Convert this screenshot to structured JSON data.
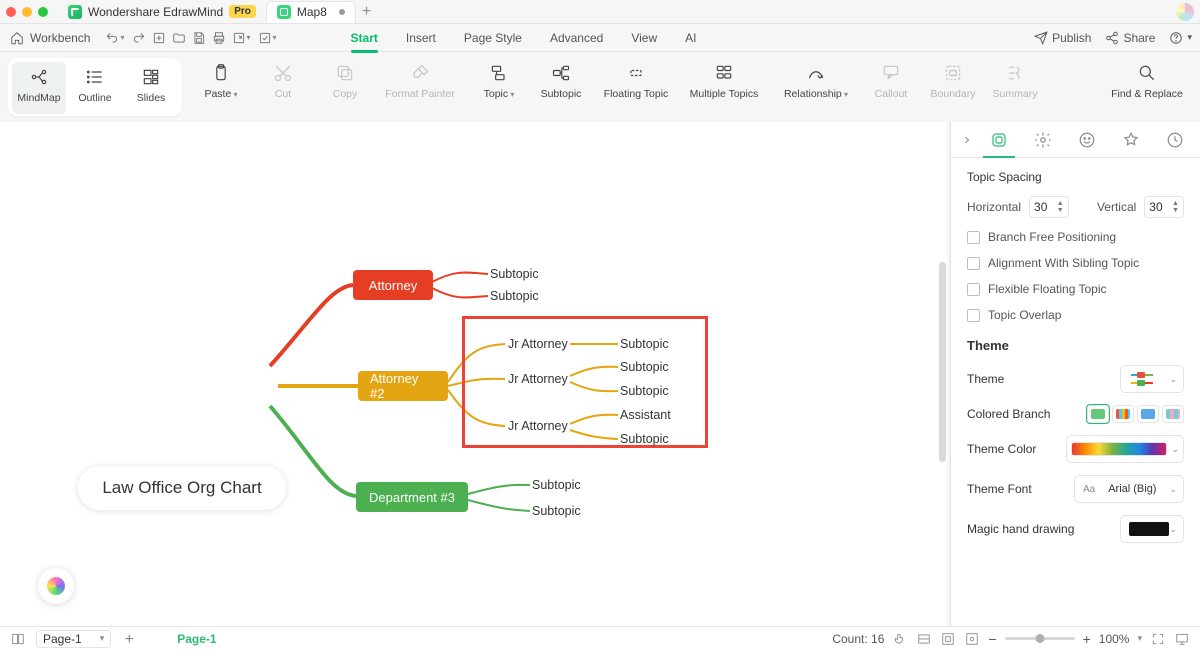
{
  "titlebar": {
    "app_name": "Wondershare EdrawMind",
    "pro_badge": "Pro",
    "doc_name": "Map8"
  },
  "menubar": {
    "workbench": "Workbench",
    "tabs": [
      "Start",
      "Insert",
      "Page Style",
      "Advanced",
      "View",
      "AI"
    ],
    "active_tab_index": 0,
    "publish": "Publish",
    "share": "Share"
  },
  "ribbon": {
    "views": [
      "MindMap",
      "Outline",
      "Slides"
    ],
    "clipboard": [
      {
        "label": "Paste",
        "caret": true,
        "disabled": false
      },
      {
        "label": "Cut",
        "disabled": true
      },
      {
        "label": "Copy",
        "disabled": true
      },
      {
        "label": "Format Painter",
        "disabled": true
      }
    ],
    "topic_group": [
      {
        "label": "Topic",
        "caret": true
      },
      {
        "label": "Subtopic"
      },
      {
        "label": "Floating Topic"
      },
      {
        "label": "Multiple Topics"
      }
    ],
    "link_group": [
      {
        "label": "Relationship",
        "caret": true
      },
      {
        "label": "Callout",
        "disabled": true
      },
      {
        "label": "Boundary",
        "disabled": true
      },
      {
        "label": "Summary",
        "disabled": true
      }
    ],
    "find_replace": "Find & Replace"
  },
  "mindmap": {
    "central": "Law Office Org Chart",
    "branch1": {
      "label": "Attorney",
      "children": [
        "Subtopic",
        "Subtopic"
      ]
    },
    "branch2": {
      "label": "Attorney #2",
      "children": [
        {
          "label": "Jr Attorney",
          "children": [
            "Subtopic"
          ]
        },
        {
          "label": "Jr Attorney",
          "children": [
            "Subtopic",
            "Subtopic"
          ]
        },
        {
          "label": "Jr Attorney",
          "children": [
            "Assistant",
            "Subtopic"
          ]
        }
      ]
    },
    "branch3": {
      "label": "Department #3",
      "children": [
        "Subtopic",
        "Subtopic"
      ]
    }
  },
  "right_panel": {
    "topic_spacing_title": "Topic Spacing",
    "horizontal_label": "Horizontal",
    "horizontal_value": "30",
    "vertical_label": "Vertical",
    "vertical_value": "30",
    "checks": [
      "Branch Free Positioning",
      "Alignment With Sibling Topic",
      "Flexible Floating Topic",
      "Topic Overlap"
    ],
    "theme_section": "Theme",
    "theme_label": "Theme",
    "colored_branch": "Colored Branch",
    "theme_color": "Theme Color",
    "theme_font": "Theme Font",
    "theme_font_value": "Arial (Big)",
    "magic_hand": "Magic hand drawing"
  },
  "statusbar": {
    "page_selector": "Page-1",
    "page_tab": "Page-1",
    "count_label": "Count: 16",
    "zoom": "100%"
  }
}
